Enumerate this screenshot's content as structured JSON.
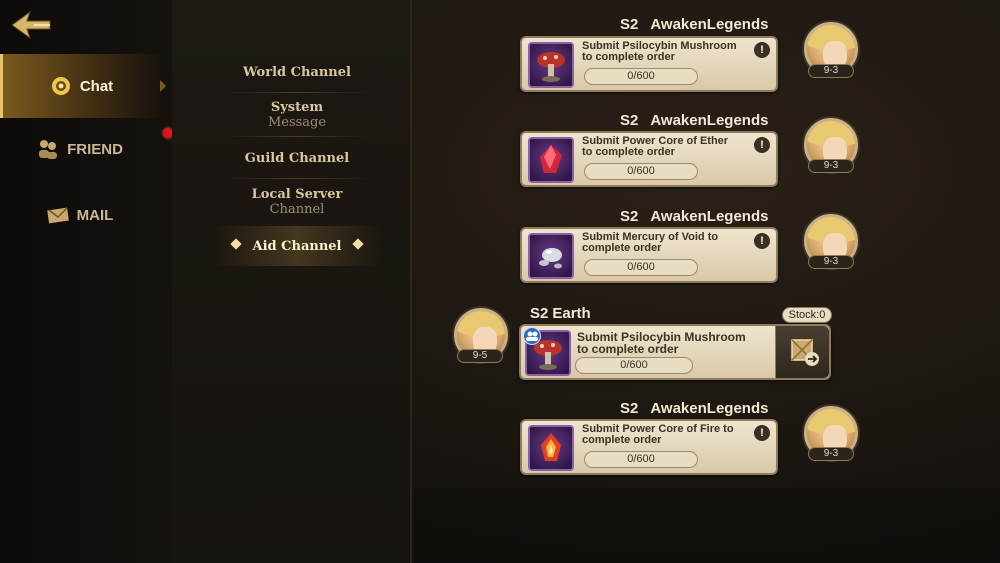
{
  "nav": {
    "items": [
      {
        "label": "Chat",
        "icon": "chat-bubble-icon",
        "active": true
      },
      {
        "label": "FRIEND",
        "icon": "friends-icon",
        "active": false,
        "notify": true
      },
      {
        "label": "MAIL",
        "icon": "envelope-icon",
        "active": false
      }
    ]
  },
  "channels": {
    "world": {
      "line1": "World Channel",
      "line2": ""
    },
    "system": {
      "line1": "System",
      "line2": "Message"
    },
    "guild": {
      "line1": "Guild Channel",
      "line2": ""
    },
    "local": {
      "line1": "Local Server",
      "line2": "Channel"
    },
    "aid": {
      "line1": "Aid Channel",
      "line2": ""
    }
  },
  "messages": [
    {
      "server": "S2",
      "name": "AwakenLegends",
      "text1": "Submit Psilocybin Mushroom",
      "text2": "to complete order",
      "progress": "0/600",
      "level": "9-3",
      "item": "mushroom-icon"
    },
    {
      "server": "S2",
      "name": "AwakenLegends",
      "text1": "Submit Power Core of Ether",
      "text2": "to complete order",
      "progress": "0/600",
      "level": "9-3",
      "item": "red-crystal-icon"
    },
    {
      "server": "S2",
      "name": "AwakenLegends",
      "text1": "Submit Mercury of Void to",
      "text2": "complete order",
      "progress": "0/600",
      "level": "9-3",
      "item": "mercury-icon"
    },
    {
      "server": "S2",
      "name": "AwakenLegends",
      "text1": "Submit Power Core of Fire to",
      "text2": "complete order",
      "progress": "0/600",
      "level": "9-3",
      "item": "fire-crystal-icon"
    }
  ],
  "own_message": {
    "server": "S2",
    "name": "Earth",
    "text1": "Submit Psilocybin Mushroom",
    "text2": "to complete order",
    "progress": "0/600",
    "level": "9-5",
    "stock": "Stock:0",
    "item": "mushroom-icon"
  },
  "colors": {
    "accent": "#e8c26a",
    "card": "#e6d9bd",
    "alert": "#e0131a"
  }
}
